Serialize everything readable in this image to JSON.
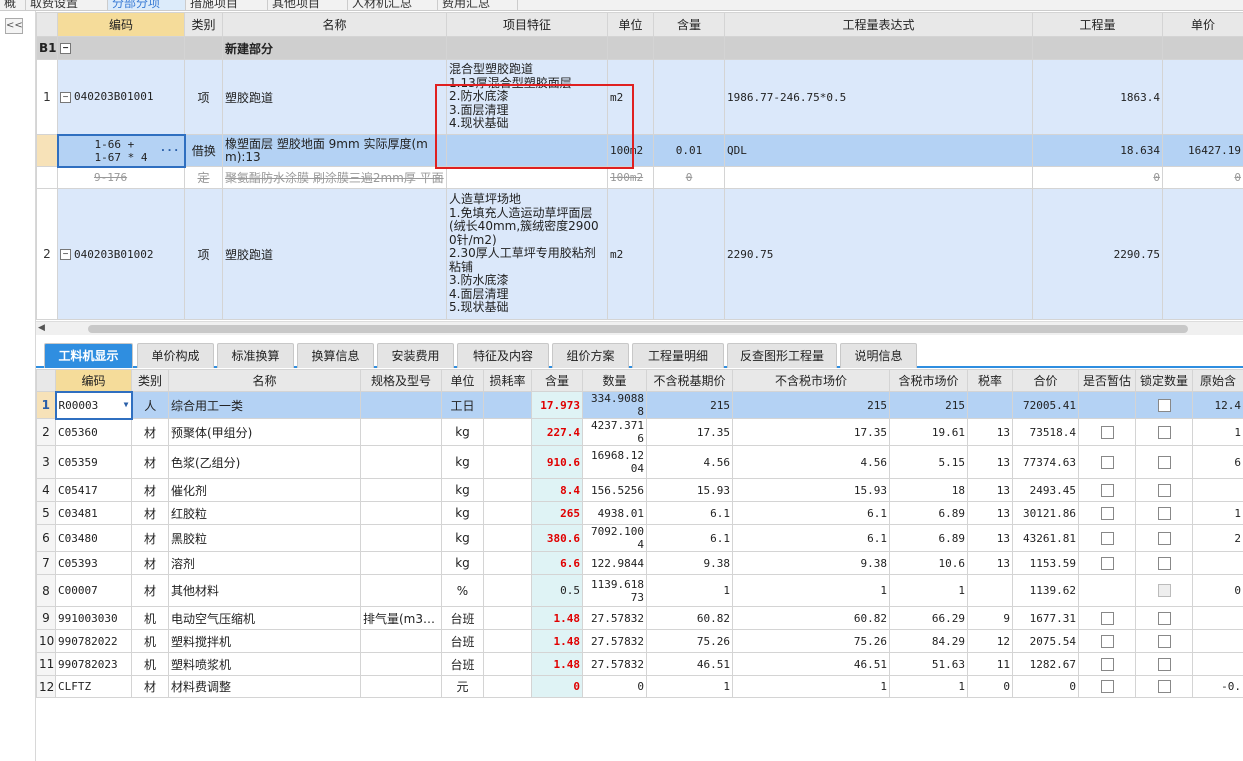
{
  "top_tabs": [
    "概况",
    "取费设置",
    "分部分项",
    "措施项目",
    "其他项目",
    "人材机汇总",
    "费用汇总"
  ],
  "upper": {
    "headers": [
      "编码",
      "类别",
      "名称",
      "项目特征",
      "单位",
      "含量",
      "工程量表达式",
      "工程量",
      "单价"
    ],
    "b1": {
      "num": "B1",
      "name": "新建部分"
    },
    "row1": {
      "num": "1",
      "code": "040203B01001",
      "type": "项",
      "name": "塑胶跑道",
      "feature": "混合型塑胶跑道\n1.13厚混合型塑胶面层\n2.防水底漆\n3.面层清理\n4.现状基础",
      "unit": "m2",
      "expr": "1986.77-246.75*0.5",
      "qty": "1863.4"
    },
    "row_sel": {
      "code": "1-66 +\n1-67 * 4",
      "ellipsis": "···",
      "type": "借换",
      "name": "橡塑面层 塑胶地面 9mm  实际厚度(mm):13",
      "unit": "100m2",
      "content": "0.01",
      "expr": "QDL",
      "qty": "18.634",
      "price": "16427.19"
    },
    "row_del": {
      "code": "9-176",
      "type": "定",
      "name": "聚氨酯防水涂膜 刷涂膜三遍2mm厚 平面",
      "unit": "100m2",
      "content": "0",
      "qty": "0",
      "price": "0"
    },
    "row2": {
      "num": "2",
      "code": "040203B01002",
      "type": "项",
      "name": "塑胶跑道",
      "feature": "人造草坪场地\n1.免填充人造运动草坪面层(绒长40mm,簇绒密度29000针/m2)\n2.30厚人工草坪专用胶粘剂粘铺\n3.防水底漆\n4.面层清理\n5.现状基础",
      "unit": "m2",
      "expr": "2290.75",
      "qty": "2290.75"
    }
  },
  "tabs": [
    "工料机显示",
    "单价构成",
    "标准换算",
    "换算信息",
    "安装费用",
    "特征及内容",
    "组价方案",
    "工程量明细",
    "反查图形工程量",
    "说明信息"
  ],
  "lower": {
    "headers": [
      "编码",
      "类别",
      "名称",
      "规格及型号",
      "单位",
      "损耗率",
      "含量",
      "数量",
      "不含税基期价",
      "不含税市场价",
      "含税市场价",
      "税率",
      "合价",
      "是否暂估",
      "锁定数量",
      "原始含"
    ],
    "rows": [
      {
        "n": "1",
        "code": "R00003",
        "type": "人",
        "name": "综合用工一类",
        "spec": "",
        "unit": "工日",
        "content": "17.973",
        "qty": "334.90888",
        "base": "215",
        "market": "215",
        "tax_market": "215",
        "rate": "",
        "total": "72005.41",
        "orig": "12.4"
      },
      {
        "n": "2",
        "code": "C05360",
        "type": "材",
        "name": "预聚体(甲组分)",
        "spec": "",
        "unit": "kg",
        "content": "227.4",
        "qty": "4237.3716",
        "base": "17.35",
        "market": "17.35",
        "tax_market": "19.61",
        "rate": "13",
        "total": "73518.4",
        "orig": "1"
      },
      {
        "n": "3",
        "code": "C05359",
        "type": "材",
        "name": "色浆(乙组分)",
        "spec": "",
        "unit": "kg",
        "content": "910.6",
        "qty": "16968.1204",
        "base": "4.56",
        "market": "4.56",
        "tax_market": "5.15",
        "rate": "13",
        "total": "77374.63",
        "orig": "6"
      },
      {
        "n": "4",
        "code": "C05417",
        "type": "材",
        "name": "催化剂",
        "spec": "",
        "unit": "kg",
        "content": "8.4",
        "qty": "156.5256",
        "base": "15.93",
        "market": "15.93",
        "tax_market": "18",
        "rate": "13",
        "total": "2493.45",
        "orig": ""
      },
      {
        "n": "5",
        "code": "C03481",
        "type": "材",
        "name": "红胶粒",
        "spec": "",
        "unit": "kg",
        "content": "265",
        "qty": "4938.01",
        "base": "6.1",
        "market": "6.1",
        "tax_market": "6.89",
        "rate": "13",
        "total": "30121.86",
        "orig": "1"
      },
      {
        "n": "6",
        "code": "C03480",
        "type": "材",
        "name": "黑胶粒",
        "spec": "",
        "unit": "kg",
        "content": "380.6",
        "qty": "7092.1004",
        "base": "6.1",
        "market": "6.1",
        "tax_market": "6.89",
        "rate": "13",
        "total": "43261.81",
        "orig": "2"
      },
      {
        "n": "7",
        "code": "C05393",
        "type": "材",
        "name": "溶剂",
        "spec": "",
        "unit": "kg",
        "content": "6.6",
        "qty": "122.9844",
        "base": "9.38",
        "market": "9.38",
        "tax_market": "10.6",
        "rate": "13",
        "total": "1153.59",
        "orig": ""
      },
      {
        "n": "8",
        "code": "C00007",
        "type": "材",
        "name": "其他材料",
        "spec": "",
        "unit": "%",
        "content": "0.5",
        "qty": "1139.61873",
        "base": "1",
        "market": "1",
        "tax_market": "1",
        "rate": "",
        "total": "1139.62",
        "orig": "0"
      },
      {
        "n": "9",
        "code": "991003030",
        "type": "机",
        "name": "电动空气压缩机",
        "spec": "排气量(m3…",
        "unit": "台班",
        "content": "1.48",
        "qty": "27.57832",
        "base": "60.82",
        "market": "60.82",
        "tax_market": "66.29",
        "rate": "9",
        "total": "1677.31",
        "orig": ""
      },
      {
        "n": "10",
        "code": "990782022",
        "type": "机",
        "name": "塑料搅拌机",
        "spec": "",
        "unit": "台班",
        "content": "1.48",
        "qty": "27.57832",
        "base": "75.26",
        "market": "75.26",
        "tax_market": "84.29",
        "rate": "12",
        "total": "2075.54",
        "orig": ""
      },
      {
        "n": "11",
        "code": "990782023",
        "type": "机",
        "name": "塑料喷浆机",
        "spec": "",
        "unit": "台班",
        "content": "1.48",
        "qty": "27.57832",
        "base": "46.51",
        "market": "46.51",
        "tax_market": "51.63",
        "rate": "11",
        "total": "1282.67",
        "orig": ""
      },
      {
        "n": "12",
        "code": "CLFTZ",
        "type": "材",
        "name": "材料费调整",
        "spec": "",
        "unit": "元",
        "content": "0",
        "qty": "0",
        "base": "1",
        "market": "1",
        "tax_market": "1",
        "rate": "0",
        "total": "0",
        "orig": "-0."
      }
    ]
  }
}
